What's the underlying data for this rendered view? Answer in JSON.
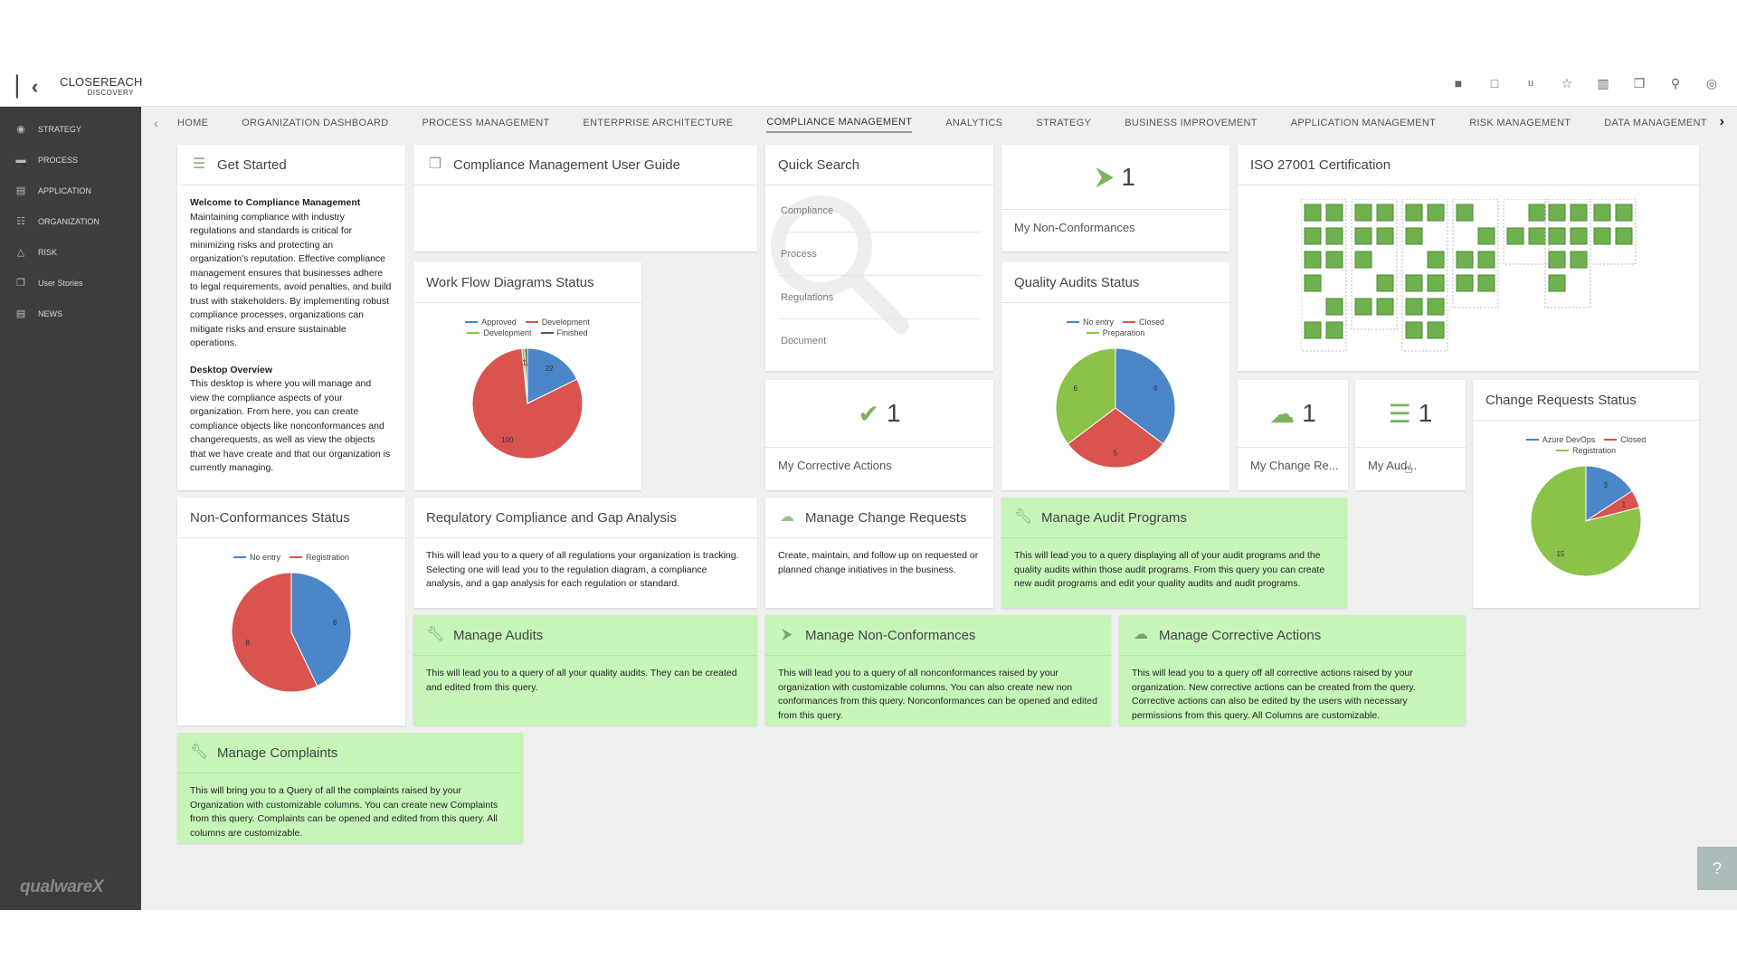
{
  "header": {
    "brand_line1": "CLOSEREACH",
    "brand_line2": "DISCOVERY",
    "tools": [
      "folder-icon",
      "monitor-icon",
      "u-icon",
      "star-icon",
      "book-icon",
      "copy-icon",
      "search-icon",
      "user-icon"
    ]
  },
  "sidebar": {
    "items": [
      {
        "label": "STRATEGY",
        "icon": "strategy-icon"
      },
      {
        "label": "PROCESS",
        "icon": "process-icon"
      },
      {
        "label": "APPLICATION",
        "icon": "application-icon"
      },
      {
        "label": "ORGANIZATION",
        "icon": "organization-icon"
      },
      {
        "label": "RISK",
        "icon": "risk-icon"
      },
      {
        "label": "User Stories",
        "icon": "user-stories-icon"
      },
      {
        "label": "NEWS",
        "icon": "news-icon"
      }
    ],
    "logo": "qualwareX"
  },
  "nav": {
    "tabs": [
      "HOME",
      "ORGANIZATION DASHBOARD",
      "PROCESS MANAGEMENT",
      "ENTERPRISE ARCHITECTURE",
      "COMPLIANCE MANAGEMENT",
      "ANALYTICS",
      "STRATEGY",
      "BUSINESS IMPROVEMENT",
      "APPLICATION MANAGEMENT",
      "RISK MANAGEMENT",
      "DATA MANAGEMENT"
    ],
    "active": 4
  },
  "colors": {
    "green": "#6fb04f",
    "red": "#d9534f",
    "blue": "#4a86c8",
    "greenSlice": "#8bc34a",
    "light_green_bg": "#c6f5b8"
  },
  "get_started": {
    "title": "Get Started",
    "heading1": "Welcome to Compliance Management",
    "para1": "Maintaining compliance with industry regulations and standards is critical for minimizing risks and protecting an organization's reputation. Effective compliance management ensures that businesses adhere to legal requirements, avoid penalties, and build trust with stakeholders. By implementing robust compliance processes, organizations can mitigate risks and ensure sustainable operations.",
    "heading2": "Desktop Overview",
    "para2": "This desktop is where you will manage and view the compliance aspects of your organization. From here, you can create compliance objects like nonconformances and changerequests, as well as view the objects that we have create and that our organization is currently managing."
  },
  "user_guide": {
    "title": "Compliance Management User Guide"
  },
  "quick_search": {
    "title": "Quick Search",
    "items": [
      "Compliance",
      "Process",
      "Regulations",
      "Document"
    ]
  },
  "non_conf_count": {
    "value": "1",
    "label": "My Non-Conformances"
  },
  "iso": {
    "title": "ISO 27001 Certification"
  },
  "workflow": {
    "title": "Work Flow Diagrams Status",
    "legend": [
      {
        "name": "Approved",
        "color": "#4a86c8"
      },
      {
        "name": "Development",
        "color": "#d9534f"
      },
      {
        "name": "Development",
        "color": "#8bc34a"
      },
      {
        "name": "Finished",
        "color": "#555555"
      }
    ]
  },
  "quality_audits": {
    "title": "Quality Audits Status",
    "legend": [
      {
        "name": "No entry",
        "color": "#4a86c8"
      },
      {
        "name": "Closed",
        "color": "#d9534f"
      },
      {
        "name": "Preparation",
        "color": "#8bc34a"
      }
    ]
  },
  "corrective": {
    "value": "1",
    "label": "My Corrective Actions"
  },
  "change_req_count": {
    "value": "1",
    "label": "My Change Re..."
  },
  "audits_count": {
    "value": "1",
    "label": "My Aud..."
  },
  "change_status": {
    "title": "Change Requests Status",
    "legend": [
      {
        "name": "Azure DevOps",
        "color": "#4a86c8"
      },
      {
        "name": "Closed",
        "color": "#d9534f"
      },
      {
        "name": "Registration",
        "color": "#8bc34a"
      }
    ]
  },
  "nc_status": {
    "title": "Non-Conformances Status",
    "legend": [
      {
        "name": "No entry",
        "color": "#4a86c8"
      },
      {
        "name": "Registration",
        "color": "#d9534f"
      }
    ]
  },
  "regulatory": {
    "title": "Requlatory Compliance and Gap Analysis",
    "text": "This will lead you to a query of all regulations your organization is tracking. Selecting one will lead you to the regulation diagram, a compliance analysis, and a gap analysis for each regulation or standard."
  },
  "manage_change": {
    "title": "Manage Change Requests",
    "text": "Create, maintain, and follow up on requested or planned change initiatives in the business."
  },
  "manage_audit_programs": {
    "title": "Manage Audit Programs",
    "text": "This will lead you to a query displaying all of your audit programs and the quality audits within those audit programs. From this query you can create new audit programs and edit your quality audits and audit programs."
  },
  "manage_audits": {
    "title": "Manage Audits",
    "text": "This will lead you to a query of all your quality audits. They can be created and edited from this query."
  },
  "manage_nc": {
    "title": "Manage Non-Conformances",
    "text": "This will lead you to a query of all nonconformances raised by your organization with customizable columns. You can also create new non conformances from this query. Nonconformances can be opened and edited from this query."
  },
  "manage_ca": {
    "title": "Manage Corrective Actions",
    "text": "This will lead you to a query off all corrective actions raised by your organization. New corrective actions can be created from the query. Corrective actions can also be edited by the users with necessary permissions from this query. All Columns are customizable."
  },
  "manage_complaints": {
    "title": "Manage Complaints",
    "text": "This will bring you to a Query of all the complaints raised by your Organization with customizable columns. You can create new Complaints from this query. Complaints can be opened and edited from this query. All columns are customizable."
  },
  "chart_data": [
    {
      "type": "pie",
      "title": "Work Flow Diagrams Status",
      "series": [
        {
          "name": "Approved",
          "value": 22
        },
        {
          "name": "Development",
          "value": 100
        },
        {
          "name": "Development",
          "value": 1
        },
        {
          "name": "Finished",
          "value": 1
        }
      ],
      "labels_shown": [
        "22",
        "100",
        "1"
      ]
    },
    {
      "type": "pie",
      "title": "Quality Audits Status",
      "series": [
        {
          "name": "No entry",
          "value": 6
        },
        {
          "name": "Closed",
          "value": 5
        },
        {
          "name": "Preparation",
          "value": 6
        }
      ]
    },
    {
      "type": "pie",
      "title": "Change Requests Status",
      "series": [
        {
          "name": "Azure DevOps",
          "value": 3
        },
        {
          "name": "Closed",
          "value": 1
        },
        {
          "name": "Registration",
          "value": 15
        }
      ]
    },
    {
      "type": "pie",
      "title": "Non-Conformances Status",
      "series": [
        {
          "name": "No entry",
          "value": 6
        },
        {
          "name": "Registration",
          "value": 8
        }
      ]
    }
  ]
}
